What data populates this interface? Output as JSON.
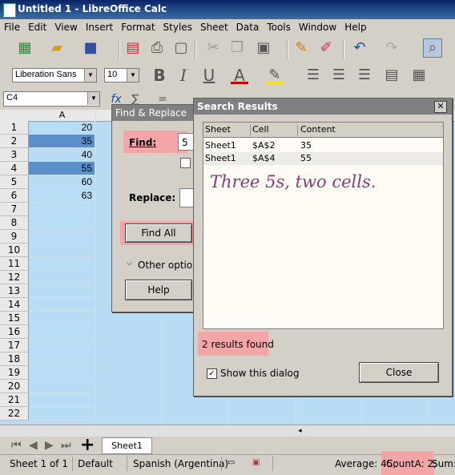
{
  "window": {
    "title": "Untitled 1 - LibreOffice Calc"
  },
  "menu": [
    "File",
    "Edit",
    "View",
    "Insert",
    "Format",
    "Styles",
    "Sheet",
    "Data",
    "Tools",
    "Window",
    "Help"
  ],
  "formatting": {
    "font_name": "Liberation Sans",
    "font_size": "10"
  },
  "name_box": "C4",
  "column_header": "A",
  "rows": [
    {
      "n": "1",
      "a": "20",
      "selected": false
    },
    {
      "n": "2",
      "a": "35",
      "selected": true
    },
    {
      "n": "3",
      "a": "40",
      "selected": false
    },
    {
      "n": "4",
      "a": "55",
      "selected": true
    },
    {
      "n": "5",
      "a": "60",
      "selected": false
    },
    {
      "n": "6",
      "a": "63",
      "selected": false
    },
    {
      "n": "7",
      "a": "",
      "selected": false
    },
    {
      "n": "8",
      "a": "",
      "selected": false
    },
    {
      "n": "9",
      "a": "",
      "selected": false
    },
    {
      "n": "10",
      "a": "",
      "selected": false
    },
    {
      "n": "11",
      "a": "",
      "selected": false
    },
    {
      "n": "12",
      "a": "",
      "selected": false
    },
    {
      "n": "13",
      "a": "",
      "selected": false
    },
    {
      "n": "14",
      "a": "",
      "selected": false
    },
    {
      "n": "15",
      "a": "",
      "selected": false
    },
    {
      "n": "16",
      "a": "",
      "selected": false
    },
    {
      "n": "17",
      "a": "",
      "selected": false
    },
    {
      "n": "18",
      "a": "",
      "selected": false
    },
    {
      "n": "19",
      "a": "",
      "selected": false
    },
    {
      "n": "20",
      "a": "",
      "selected": false
    },
    {
      "n": "21",
      "a": "",
      "selected": false
    },
    {
      "n": "22",
      "a": "",
      "selected": false
    }
  ],
  "find_replace": {
    "title": "Find & Replace",
    "find_label": "Find:",
    "find_value": "5",
    "replace_label": "Replace:",
    "find_all": "Find All",
    "other_options": "Other options",
    "help": "Help"
  },
  "search_results": {
    "title": "Search Results",
    "columns": [
      "Sheet",
      "Cell",
      "Content"
    ],
    "results": [
      {
        "sheet": "Sheet1",
        "cell": "$A$2",
        "content": "35"
      },
      {
        "sheet": "Sheet1",
        "cell": "$A$4",
        "content": "55"
      }
    ],
    "annotation": "Three 5s, two cells.",
    "count_text": "2 results found",
    "show_dialog_label": "Show this dialog",
    "show_dialog_checked": true,
    "close": "Close"
  },
  "sheet_tab": "Sheet1",
  "status": {
    "sheet": "Sheet 1 of 1",
    "style": "Default",
    "language": "Spanish (Argentina)",
    "average": "Average: 45;",
    "count": "CountA: 2;",
    "sum": "Sum:"
  },
  "colors": {
    "selection": "#5b8fc8",
    "highlight": "#f4a6a6",
    "grid_bg": "#b9dcf5",
    "annotation": "#8a3a7a"
  }
}
